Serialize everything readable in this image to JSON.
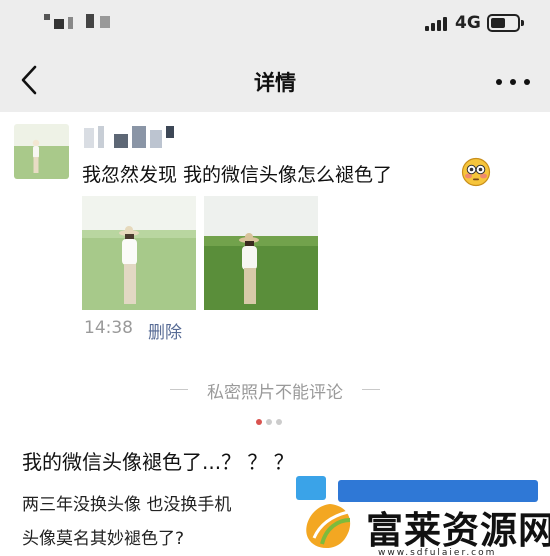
{
  "status_bar": {
    "carrier": "",
    "network": "4G",
    "battery_level": 0.55
  },
  "nav": {
    "title": "详情",
    "back_icon": "chevron-left-icon",
    "more_icon": "ellipsis-icon"
  },
  "post": {
    "username": "",
    "text": "我忽然发现 我的微信头像怎么褪色了",
    "emoji": "flushed-face-emoji",
    "photos": [
      {
        "label": "faded-photo",
        "style": "faded"
      },
      {
        "label": "original-photo",
        "style": "vivid"
      }
    ],
    "time": "14:38",
    "delete_label": "删除"
  },
  "comment_notice": "私密照片不能评论",
  "carousel": {
    "count": 3,
    "active_index": 0
  },
  "article": {
    "title": "我的微信头像褪色了...？ ？ ？",
    "lines": [
      "两三年没换头像  也没换手机",
      "头像莫名其妙褪色了?"
    ]
  },
  "watermark": {
    "name": "富莱资源网",
    "url": "www.sdfulaier.com"
  },
  "colors": {
    "nav_background": "#ededed",
    "link_blue": "#576b95",
    "carousel_active": "#d9534f",
    "carousel_inactive": "#cccccc"
  }
}
